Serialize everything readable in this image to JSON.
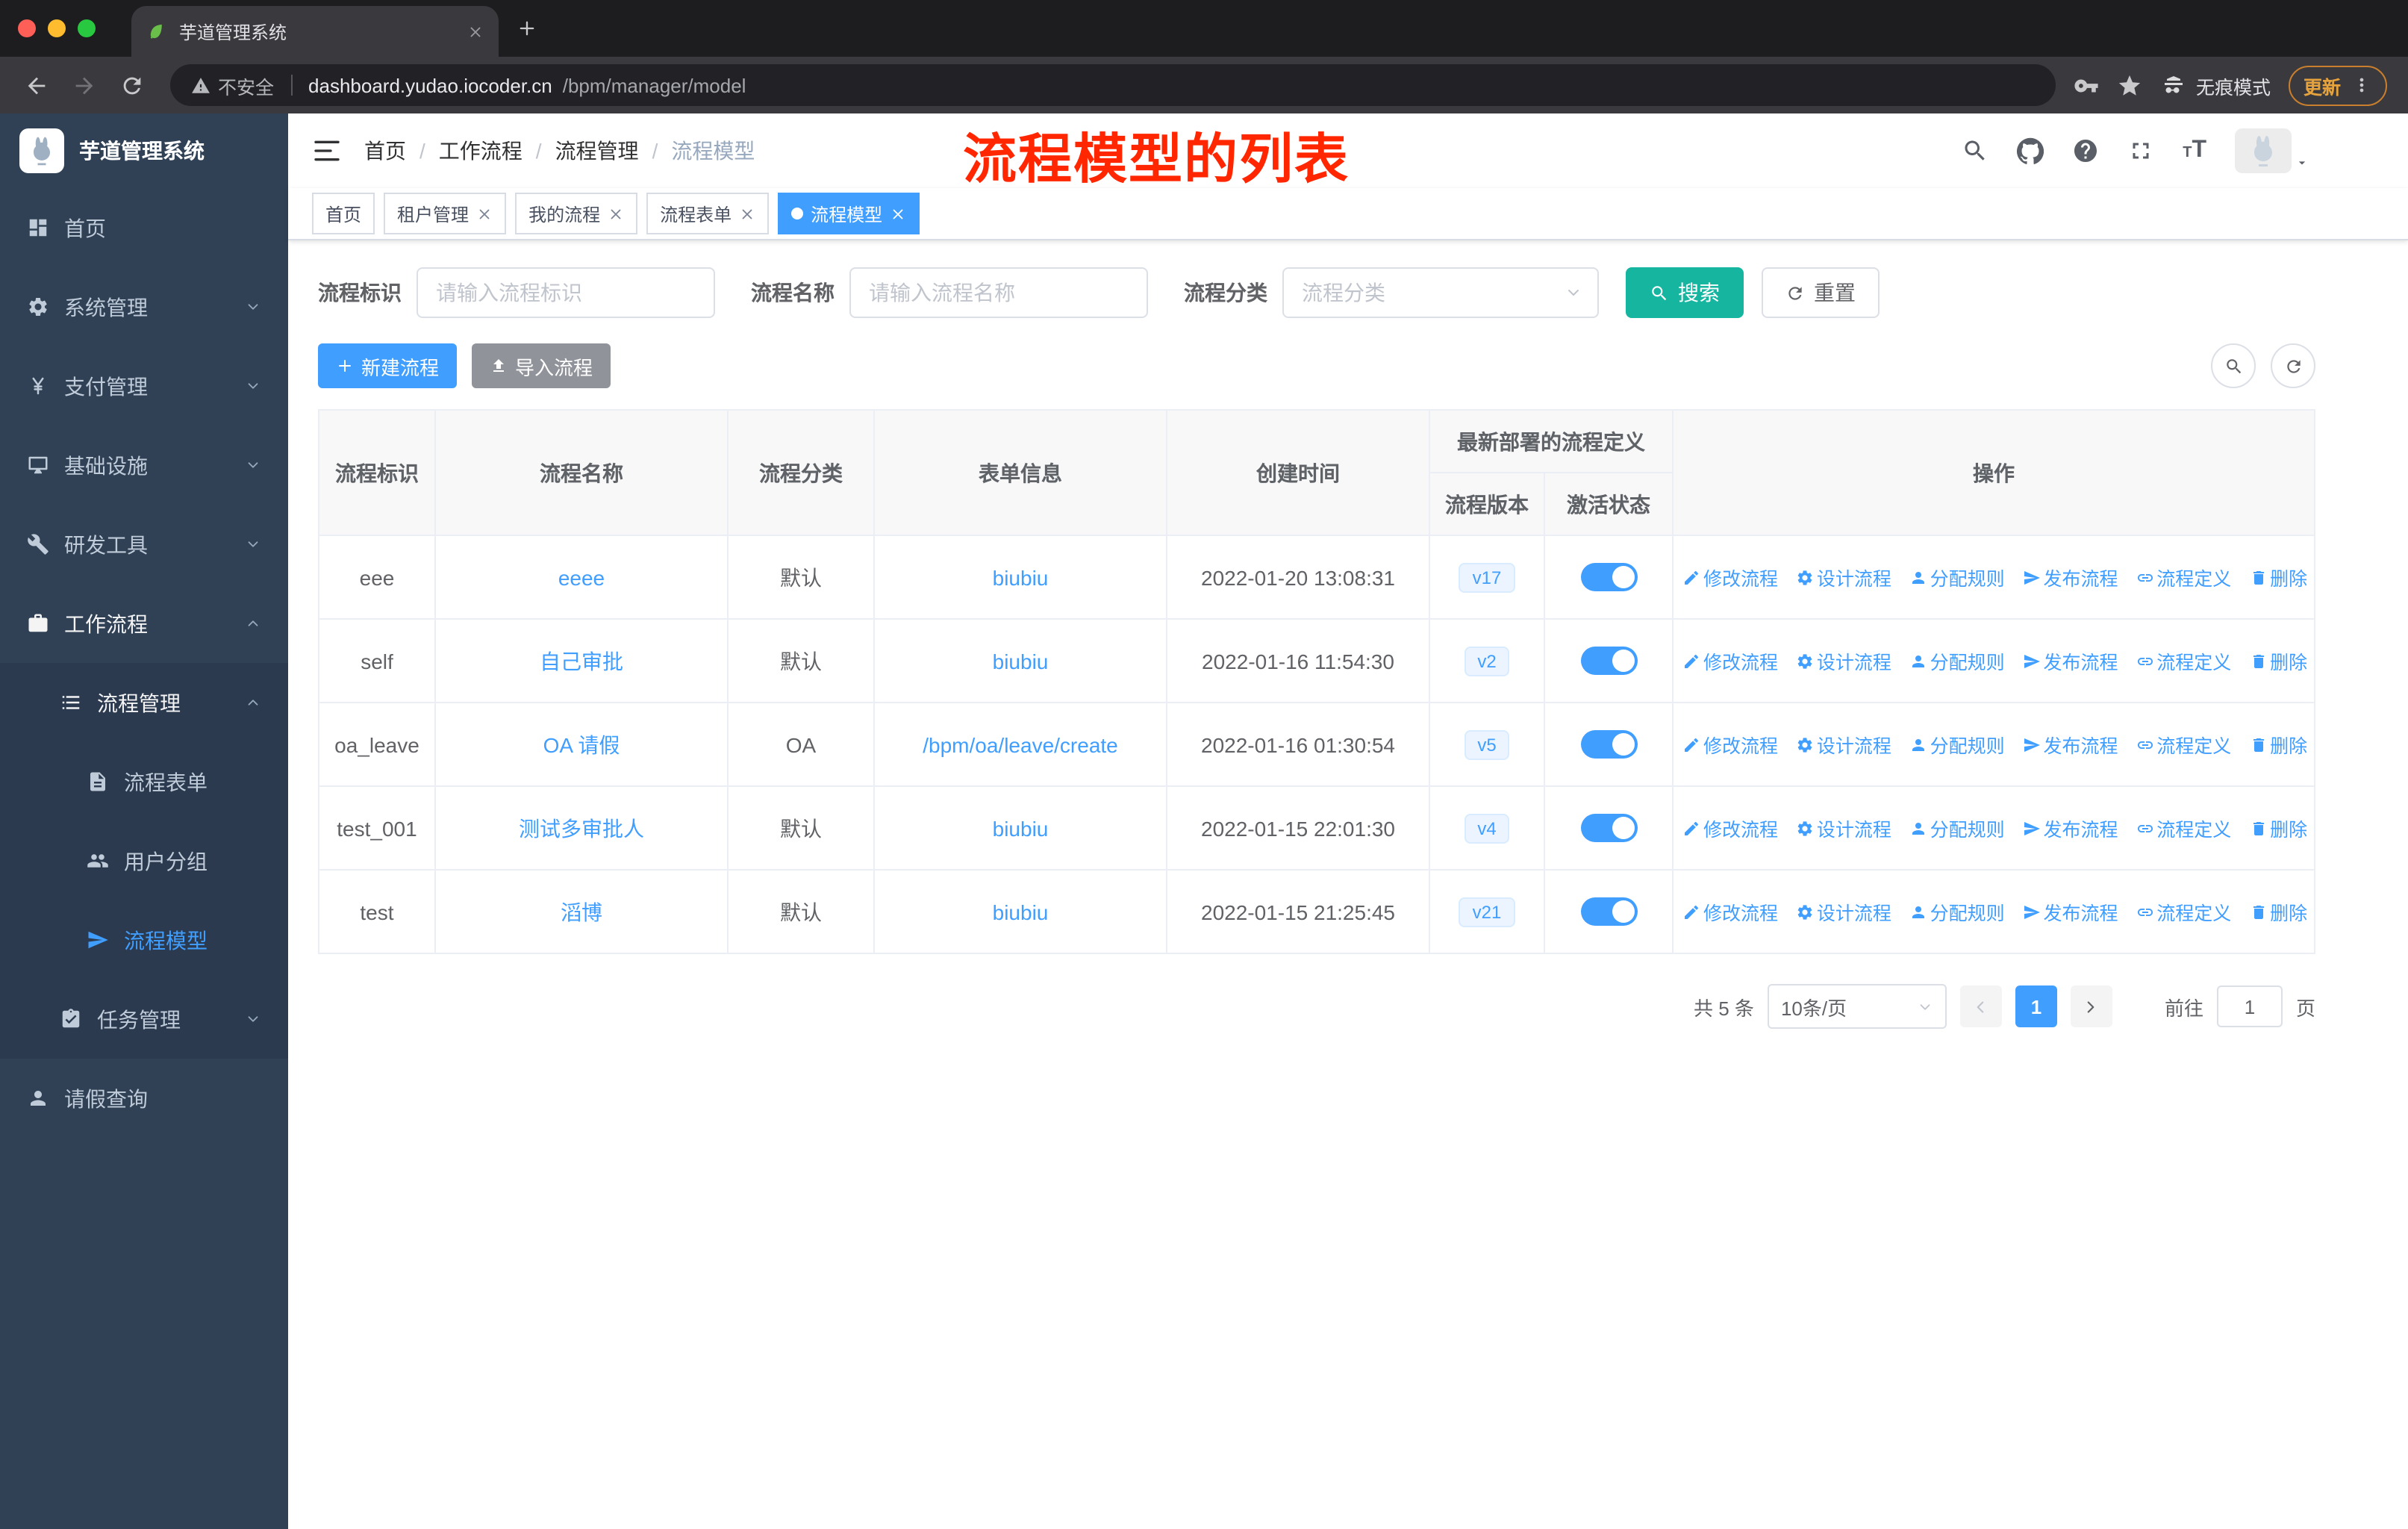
{
  "colors": {
    "accent": "#409EFF",
    "search_button": "#16B5A0",
    "import_button": "#909399",
    "sidebar_bg": "#304156",
    "annotation_red": "#FF2600",
    "update_chip": "#E6A23C",
    "version_tag_bg": "#ECF5FF"
  },
  "browser": {
    "tab_title": "芋道管理系统",
    "security_label": "不安全",
    "url_domain": "dashboard.yudao.iocoder.cn",
    "url_path": "/bpm/manager/model",
    "incognito_label": "无痕模式",
    "update_label": "更新"
  },
  "sidebar": {
    "logo_title": "芋道管理系统",
    "items": [
      {
        "label": "首页",
        "icon": "dashboard-icon",
        "level": 1
      },
      {
        "label": "系统管理",
        "icon": "gear-icon",
        "level": 1,
        "expandable": true
      },
      {
        "label": "支付管理",
        "icon": "yen-icon",
        "level": 1,
        "expandable": true
      },
      {
        "label": "基础设施",
        "icon": "monitor-icon",
        "level": 1,
        "expandable": true
      },
      {
        "label": "研发工具",
        "icon": "wrench-icon",
        "level": 1,
        "expandable": true
      },
      {
        "label": "工作流程",
        "icon": "briefcase-icon",
        "level": 1,
        "expandable": true,
        "expanded": true
      },
      {
        "label": "流程管理",
        "icon": "list-icon",
        "level": 2,
        "expandable": true,
        "expanded": true
      },
      {
        "label": "流程表单",
        "icon": "document-icon",
        "level": 3
      },
      {
        "label": "用户分组",
        "icon": "users-icon",
        "level": 3
      },
      {
        "label": "流程模型",
        "icon": "paper-plane-icon",
        "level": 3,
        "active": true
      },
      {
        "label": "任务管理",
        "icon": "task-icon",
        "level": 2,
        "expandable": true
      },
      {
        "label": "请假查询",
        "icon": "user-icon",
        "level": 1
      }
    ]
  },
  "navbar": {
    "breadcrumb": [
      "首页",
      "工作流程",
      "流程管理",
      "流程模型"
    ],
    "annotation": "流程模型的列表",
    "header_icons": [
      "search-icon",
      "github-icon",
      "help-icon",
      "fullscreen-icon",
      "font-size-icon",
      "avatar"
    ]
  },
  "tags": [
    {
      "label": "首页",
      "closable": false,
      "active": false
    },
    {
      "label": "租户管理",
      "closable": true,
      "active": false
    },
    {
      "label": "我的流程",
      "closable": true,
      "active": false
    },
    {
      "label": "流程表单",
      "closable": true,
      "active": false
    },
    {
      "label": "流程模型",
      "closable": true,
      "active": true
    }
  ],
  "filters": {
    "id_label": "流程标识",
    "id_placeholder": "请输入流程标识",
    "name_label": "流程名称",
    "name_placeholder": "请输入流程名称",
    "category_label": "流程分类",
    "category_placeholder": "流程分类",
    "search_label": "搜索",
    "reset_label": "重置"
  },
  "toolbar": {
    "create_label": "新建流程",
    "import_label": "导入流程"
  },
  "table": {
    "col_id": "流程标识",
    "col_name": "流程名称",
    "col_category": "流程分类",
    "col_form": "表单信息",
    "col_time": "创建时间",
    "col_group": "最新部署的流程定义",
    "col_version": "流程版本",
    "col_status": "激活状态",
    "col_actions": "操作",
    "actions": [
      {
        "label": "修改流程",
        "icon": "edit-icon"
      },
      {
        "label": "设计流程",
        "icon": "design-gear-icon"
      },
      {
        "label": "分配规则",
        "icon": "assign-user-icon"
      },
      {
        "label": "发布流程",
        "icon": "publish-icon"
      },
      {
        "label": "流程定义",
        "icon": "link-icon"
      },
      {
        "label": "删除",
        "icon": "trash-icon"
      }
    ],
    "rows": [
      {
        "id": "eee",
        "name": "eeee",
        "category": "默认",
        "form": "biubiu",
        "time": "2022-01-20 13:08:31",
        "version": "v17",
        "active": true
      },
      {
        "id": "self",
        "name": "自己审批",
        "category": "默认",
        "form": "biubiu",
        "time": "2022-01-16 11:54:30",
        "version": "v2",
        "active": true
      },
      {
        "id": "oa_leave",
        "name": "OA 请假",
        "category": "OA",
        "form": "/bpm/oa/leave/create",
        "time": "2022-01-16 01:30:54",
        "version": "v5",
        "active": true
      },
      {
        "id": "test_001",
        "name": "测试多审批人",
        "category": "默认",
        "form": "biubiu",
        "time": "2022-01-15 22:01:30",
        "version": "v4",
        "active": true
      },
      {
        "id": "test",
        "name": "滔博",
        "category": "默认",
        "form": "biubiu",
        "time": "2022-01-15 21:25:45",
        "version": "v21",
        "active": true
      }
    ]
  },
  "pagination": {
    "total": "共 5 条",
    "page_size": "10条/页",
    "current": "1",
    "jump_prefix": "前往",
    "jump_value": "1",
    "jump_suffix": "页"
  }
}
